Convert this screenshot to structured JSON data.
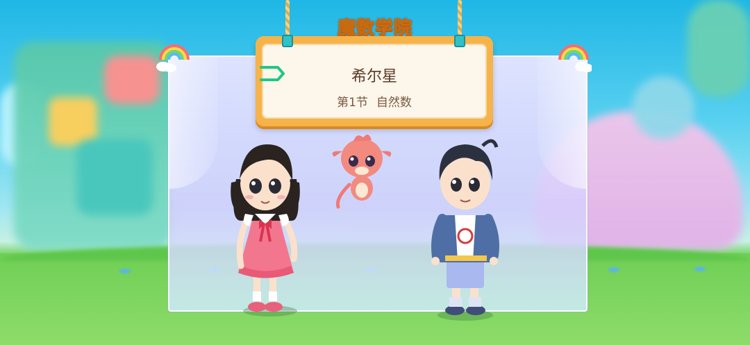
{
  "header": {
    "academy_title": "魔数学院"
  },
  "sign": {
    "planet_name": "希尔星",
    "lesson_number": "第1节",
    "lesson_title": "自然数"
  },
  "colors": {
    "sign_frame": "#f5b34a",
    "sign_panel": "#fdf6ea",
    "title_fill": "#ffe04a",
    "back_icon": "#1fc78a"
  },
  "characters": [
    {
      "name": "girl"
    },
    {
      "name": "pet-dragon"
    },
    {
      "name": "boy"
    }
  ]
}
